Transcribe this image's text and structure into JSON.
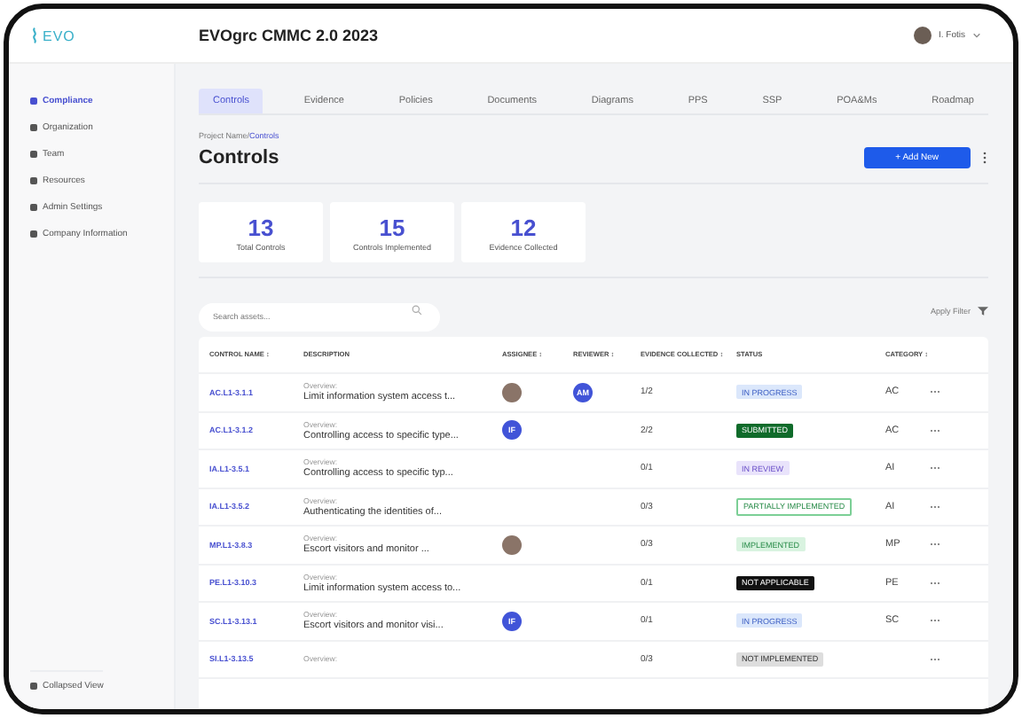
{
  "header": {
    "logo": "EVO",
    "title": "EVOgrc CMMC 2.0 2023",
    "user": "I. Fotis"
  },
  "sidebar": {
    "items": [
      {
        "label": "Compliance",
        "selected": true
      },
      {
        "label": "Organization",
        "selected": false
      },
      {
        "label": "Team",
        "selected": false
      },
      {
        "label": "Resources",
        "selected": false
      },
      {
        "label": "Admin Settings",
        "selected": false
      },
      {
        "label": "Company Information",
        "selected": false
      }
    ],
    "footer": "Collapsed View"
  },
  "tabs": [
    {
      "label": "Controls",
      "selected": true
    },
    {
      "label": "Evidence",
      "selected": false
    },
    {
      "label": "Policies",
      "selected": false
    },
    {
      "label": "Documents",
      "selected": false
    },
    {
      "label": "Diagrams",
      "selected": false
    },
    {
      "label": "PPS",
      "selected": false
    },
    {
      "label": "SSP",
      "selected": false
    },
    {
      "label": "POA&Ms",
      "selected": false
    },
    {
      "label": "Roadmap",
      "selected": false
    }
  ],
  "breadcrumb": {
    "parent": "Project Name/",
    "current": "Controls"
  },
  "page_title": "Controls",
  "add_button": "+ Add New",
  "stats": [
    {
      "value": "13",
      "label": "Total Controls"
    },
    {
      "value": "15",
      "label": "Controls Implemented"
    },
    {
      "value": "12",
      "label": "Evidence Collected"
    }
  ],
  "search": {
    "placeholder": "Search assets..."
  },
  "filter": "Apply Filter",
  "table": {
    "columns": [
      "CONTROL NAME ↕",
      "DESCRIPTION",
      "ASSIGNEE ↕",
      "REVIEWER ↕",
      "EVIDENCE COLLECTED ↕",
      "STATUS",
      "CATEGORY ↕"
    ],
    "rows": [
      {
        "control": "AC.L1-3.1.1",
        "overview": "Overview:",
        "description": "Limit information system access t...",
        "assignee": {
          "kind": "photo"
        },
        "reviewer": {
          "kind": "initials",
          "text": "AM"
        },
        "evidence": "1/2",
        "status": {
          "kind": "in_progress",
          "label": "IN PROGRESS"
        },
        "category": "AC"
      },
      {
        "control": "AC.L1-3.1.2",
        "overview": "Overview:",
        "description": "Controlling access to specific type...",
        "assignee": {
          "kind": "initials",
          "text": "IF"
        },
        "reviewer": {
          "kind": "none"
        },
        "evidence": "2/2",
        "status": {
          "kind": "submitted",
          "label": "SUBMITTED"
        },
        "category": "AC"
      },
      {
        "control": "IA.L1-3.5.1",
        "overview": "Overview:",
        "description": "Controlling access to specific typ...",
        "assignee": {
          "kind": "none"
        },
        "reviewer": {
          "kind": "none"
        },
        "evidence": "0/1",
        "status": {
          "kind": "in_review",
          "label": "IN REVIEW"
        },
        "category": "AI"
      },
      {
        "control": "IA.L1-3.5.2",
        "overview": "Overview:",
        "description": "Authenticating the identities of...",
        "assignee": {
          "kind": "none"
        },
        "reviewer": {
          "kind": "none"
        },
        "evidence": "0/3",
        "status": {
          "kind": "partial",
          "label": "PARTIALLY IMPLEMENTED"
        },
        "category": "AI"
      },
      {
        "control": "MP.L1-3.8.3",
        "overview": "Overview:",
        "description": "Escort visitors and monitor ...",
        "assignee": {
          "kind": "photo"
        },
        "reviewer": {
          "kind": "none"
        },
        "evidence": "0/3",
        "status": {
          "kind": "implemented",
          "label": "IMPLEMENTED"
        },
        "category": "MP"
      },
      {
        "control": "PE.L1-3.10.3",
        "overview": "Overview:",
        "description": "Limit information system access to...",
        "assignee": {
          "kind": "none"
        },
        "reviewer": {
          "kind": "none"
        },
        "evidence": "0/1",
        "status": {
          "kind": "not_applicable",
          "label": "NOT APPLICABLE"
        },
        "category": "PE"
      },
      {
        "control": "SC.L1-3.13.1",
        "overview": "Overview:",
        "description": "Escort visitors and monitor visi...",
        "assignee": {
          "kind": "initials",
          "text": "IF"
        },
        "reviewer": {
          "kind": "none"
        },
        "evidence": "0/1",
        "status": {
          "kind": "in_progress",
          "label": "IN PROGRESS"
        },
        "category": "SC"
      },
      {
        "control": "SI.L1-3.13.5",
        "overview": "Overview:",
        "description": "",
        "assignee": {
          "kind": "none"
        },
        "reviewer": {
          "kind": "none"
        },
        "evidence": "0/3",
        "status": {
          "kind": "not_implemented",
          "label": "NOT IMPLEMENTED"
        },
        "category": ""
      }
    ]
  }
}
